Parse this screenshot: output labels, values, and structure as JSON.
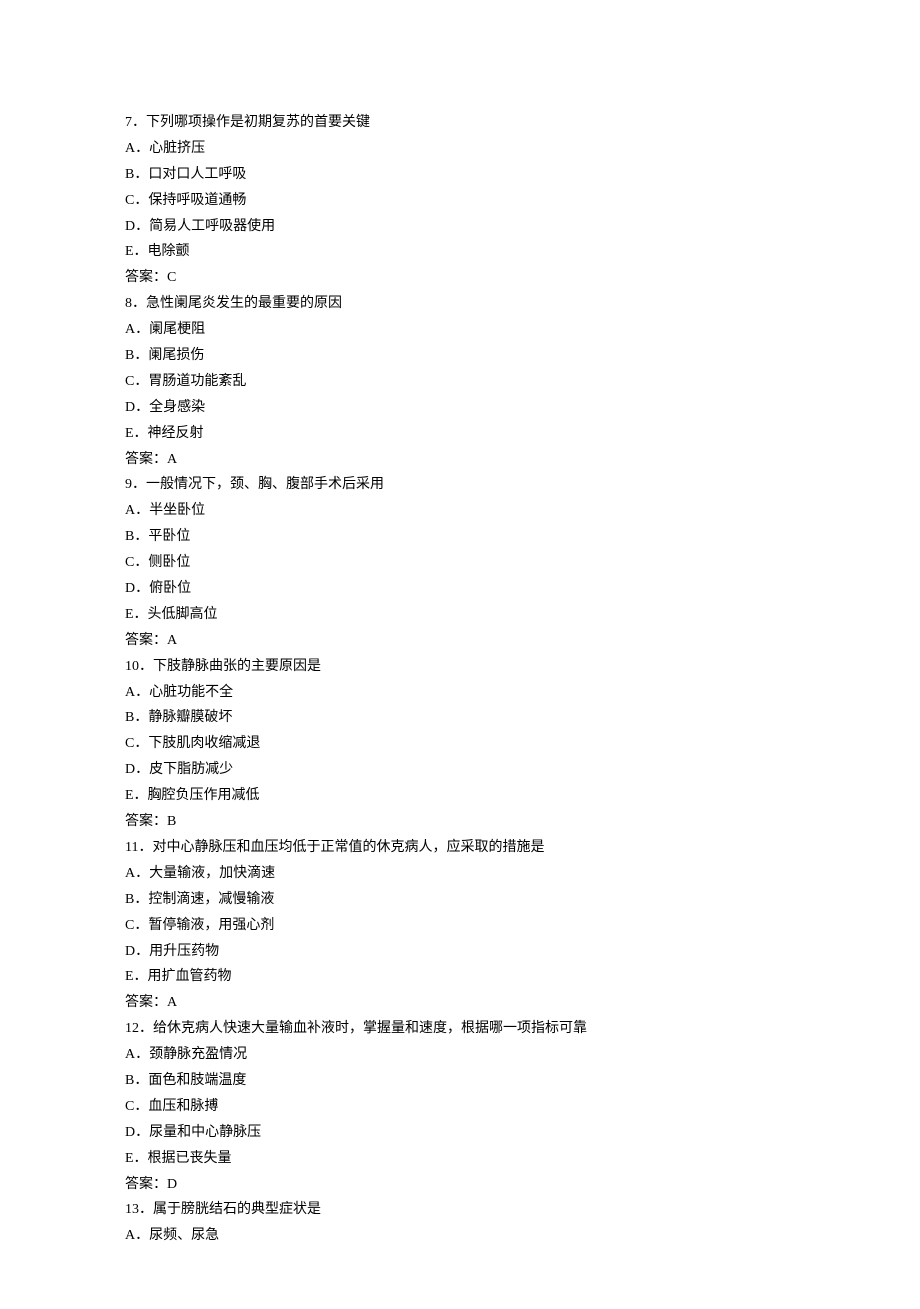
{
  "questions": [
    {
      "number": "7",
      "stem": "下列哪项操作是初期复苏的首要关键",
      "options": [
        "A．心脏挤压",
        "B．口对口人工呼吸",
        "C．保持呼吸道通畅",
        "D．简易人工呼吸器使用",
        "E．电除颤"
      ],
      "answer": "答案：C"
    },
    {
      "number": "8",
      "stem": "急性阑尾炎发生的最重要的原因",
      "options": [
        "A．阑尾梗阻",
        "B．阑尾损伤",
        "C．胃肠道功能紊乱",
        "D．全身感染",
        "E．神经反射"
      ],
      "answer": "答案：A"
    },
    {
      "number": "9",
      "stem": "一般情况下，颈、胸、腹部手术后采用",
      "options": [
        "A．半坐卧位",
        "B．平卧位",
        "C．侧卧位",
        "D．俯卧位",
        "E．头低脚高位"
      ],
      "answer": "答案：A"
    },
    {
      "number": "10",
      "stem": "下肢静脉曲张的主要原因是",
      "options": [
        "A．心脏功能不全",
        "B．静脉瓣膜破坏",
        "C．下肢肌肉收缩减退",
        "D．皮下脂肪减少",
        "E．胸腔负压作用减低"
      ],
      "answer": "答案：B"
    },
    {
      "number": "11",
      "stem": "对中心静脉压和血压均低于正常值的休克病人，应采取的措施是",
      "options": [
        "A．大量输液，加快滴速",
        "B．控制滴速，减慢输液",
        "C．暂停输液，用强心剂",
        "D．用升压药物",
        "E．用扩血管药物"
      ],
      "answer": "答案：A"
    },
    {
      "number": "12",
      "stem": "给休克病人快速大量输血补液时，掌握量和速度，根据哪一项指标可靠",
      "options": [
        "A．颈静脉充盈情况",
        "B．面色和肢端温度",
        "C．血压和脉搏",
        "D．尿量和中心静脉压",
        "E．根据已丧失量"
      ],
      "answer": "答案：D"
    },
    {
      "number": "13",
      "stem": "属于膀胱结石的典型症状是",
      "options": [
        "A．尿频、尿急"
      ],
      "answer": ""
    }
  ]
}
